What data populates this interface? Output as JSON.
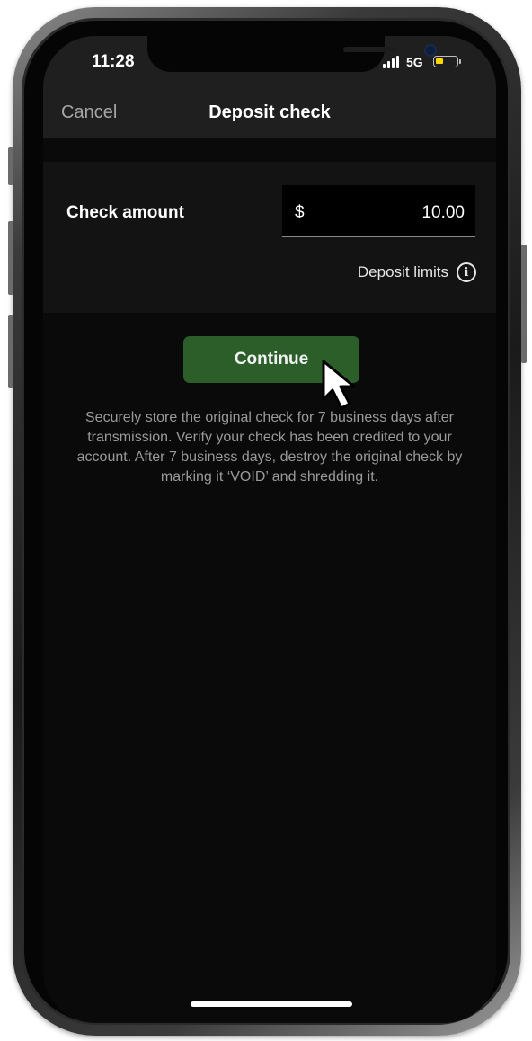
{
  "status_bar": {
    "time": "11:28",
    "network": "5G",
    "battery_level": 0.35,
    "battery_color": "#ffd60a"
  },
  "nav": {
    "cancel_label": "Cancel",
    "title": "Deposit check"
  },
  "amount": {
    "label": "Check amount",
    "currency": "$",
    "value": "10.00",
    "limits_label": "Deposit limits",
    "info_icon": "info-icon"
  },
  "continue_label": "Continue",
  "disclaimer": "Securely store the original check for 7 business days after transmission. Verify your check has been credited to your account. After 7 business days, destroy the original check by marking it ‘VOID’ and shredding it.",
  "colors": {
    "accent": "#2c5e2a",
    "background": "#0a0a0a",
    "card": "#131313",
    "bar": "#1f1f1f"
  }
}
